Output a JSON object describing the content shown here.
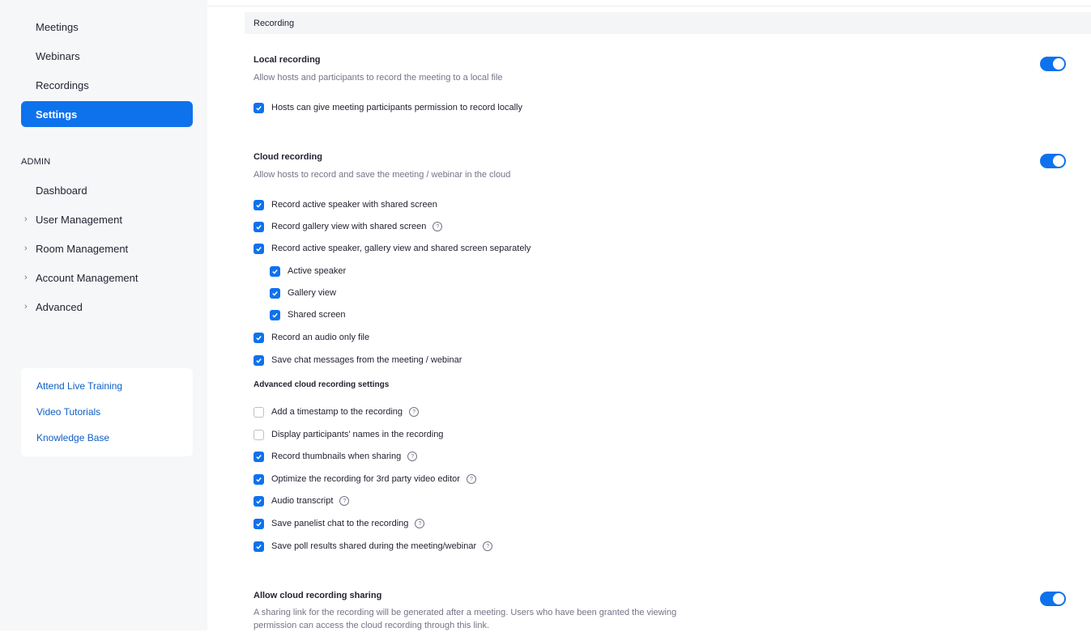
{
  "sidebar": {
    "nav": [
      {
        "label": "Meetings",
        "active": false
      },
      {
        "label": "Webinars",
        "active": false
      },
      {
        "label": "Recordings",
        "active": false
      },
      {
        "label": "Settings",
        "active": true
      }
    ],
    "admin_label": "ADMIN",
    "admin_items": [
      {
        "label": "Dashboard",
        "expandable": false
      },
      {
        "label": "User Management",
        "expandable": true
      },
      {
        "label": "Room Management",
        "expandable": true
      },
      {
        "label": "Account Management",
        "expandable": true
      },
      {
        "label": "Advanced",
        "expandable": true
      }
    ],
    "help_links": [
      "Attend Live Training",
      "Video Tutorials",
      "Knowledge Base"
    ]
  },
  "main": {
    "section_title": "Recording",
    "local_recording": {
      "title": "Local recording",
      "description": "Allow hosts and participants to record the meeting to a local file",
      "enabled": true,
      "options": [
        {
          "label": "Hosts can give meeting participants permission to record locally",
          "checked": true
        }
      ]
    },
    "cloud_recording": {
      "title": "Cloud recording",
      "description": "Allow hosts to record and save the meeting / webinar in the cloud",
      "enabled": true,
      "options": [
        {
          "label": "Record active speaker with shared screen",
          "checked": true,
          "info": false,
          "indent": 0
        },
        {
          "label": "Record gallery view with shared screen",
          "checked": true,
          "info": true,
          "indent": 0
        },
        {
          "label": "Record active speaker, gallery view and shared screen separately",
          "checked": true,
          "info": false,
          "indent": 0
        },
        {
          "label": "Active speaker",
          "checked": true,
          "info": false,
          "indent": 1
        },
        {
          "label": "Gallery view",
          "checked": true,
          "info": false,
          "indent": 1
        },
        {
          "label": "Shared screen",
          "checked": true,
          "info": false,
          "indent": 1
        },
        {
          "label": "Record an audio only file",
          "checked": true,
          "info": false,
          "indent": 0
        },
        {
          "label": "Save chat messages from the meeting / webinar",
          "checked": true,
          "info": false,
          "indent": 0
        }
      ],
      "advanced_heading": "Advanced cloud recording settings",
      "advanced_options": [
        {
          "label": "Add a timestamp to the recording",
          "checked": false,
          "info": true
        },
        {
          "label": "Display participants' names in the recording",
          "checked": false,
          "info": false
        },
        {
          "label": "Record thumbnails when sharing",
          "checked": true,
          "info": true
        },
        {
          "label": "Optimize the recording for 3rd party video editor",
          "checked": true,
          "info": true
        },
        {
          "label": "Audio transcript",
          "checked": true,
          "info": true
        },
        {
          "label": "Save panelist chat to the recording",
          "checked": true,
          "info": true
        },
        {
          "label": "Save poll results shared during the meeting/webinar",
          "checked": true,
          "info": true
        }
      ]
    },
    "cloud_sharing": {
      "title": "Allow cloud recording sharing",
      "description": "A sharing link for the recording will be generated after a meeting. Users who have been granted the viewing permission can access the cloud recording through this link.",
      "enabled": true
    },
    "accent_color": "#0e72ed"
  }
}
